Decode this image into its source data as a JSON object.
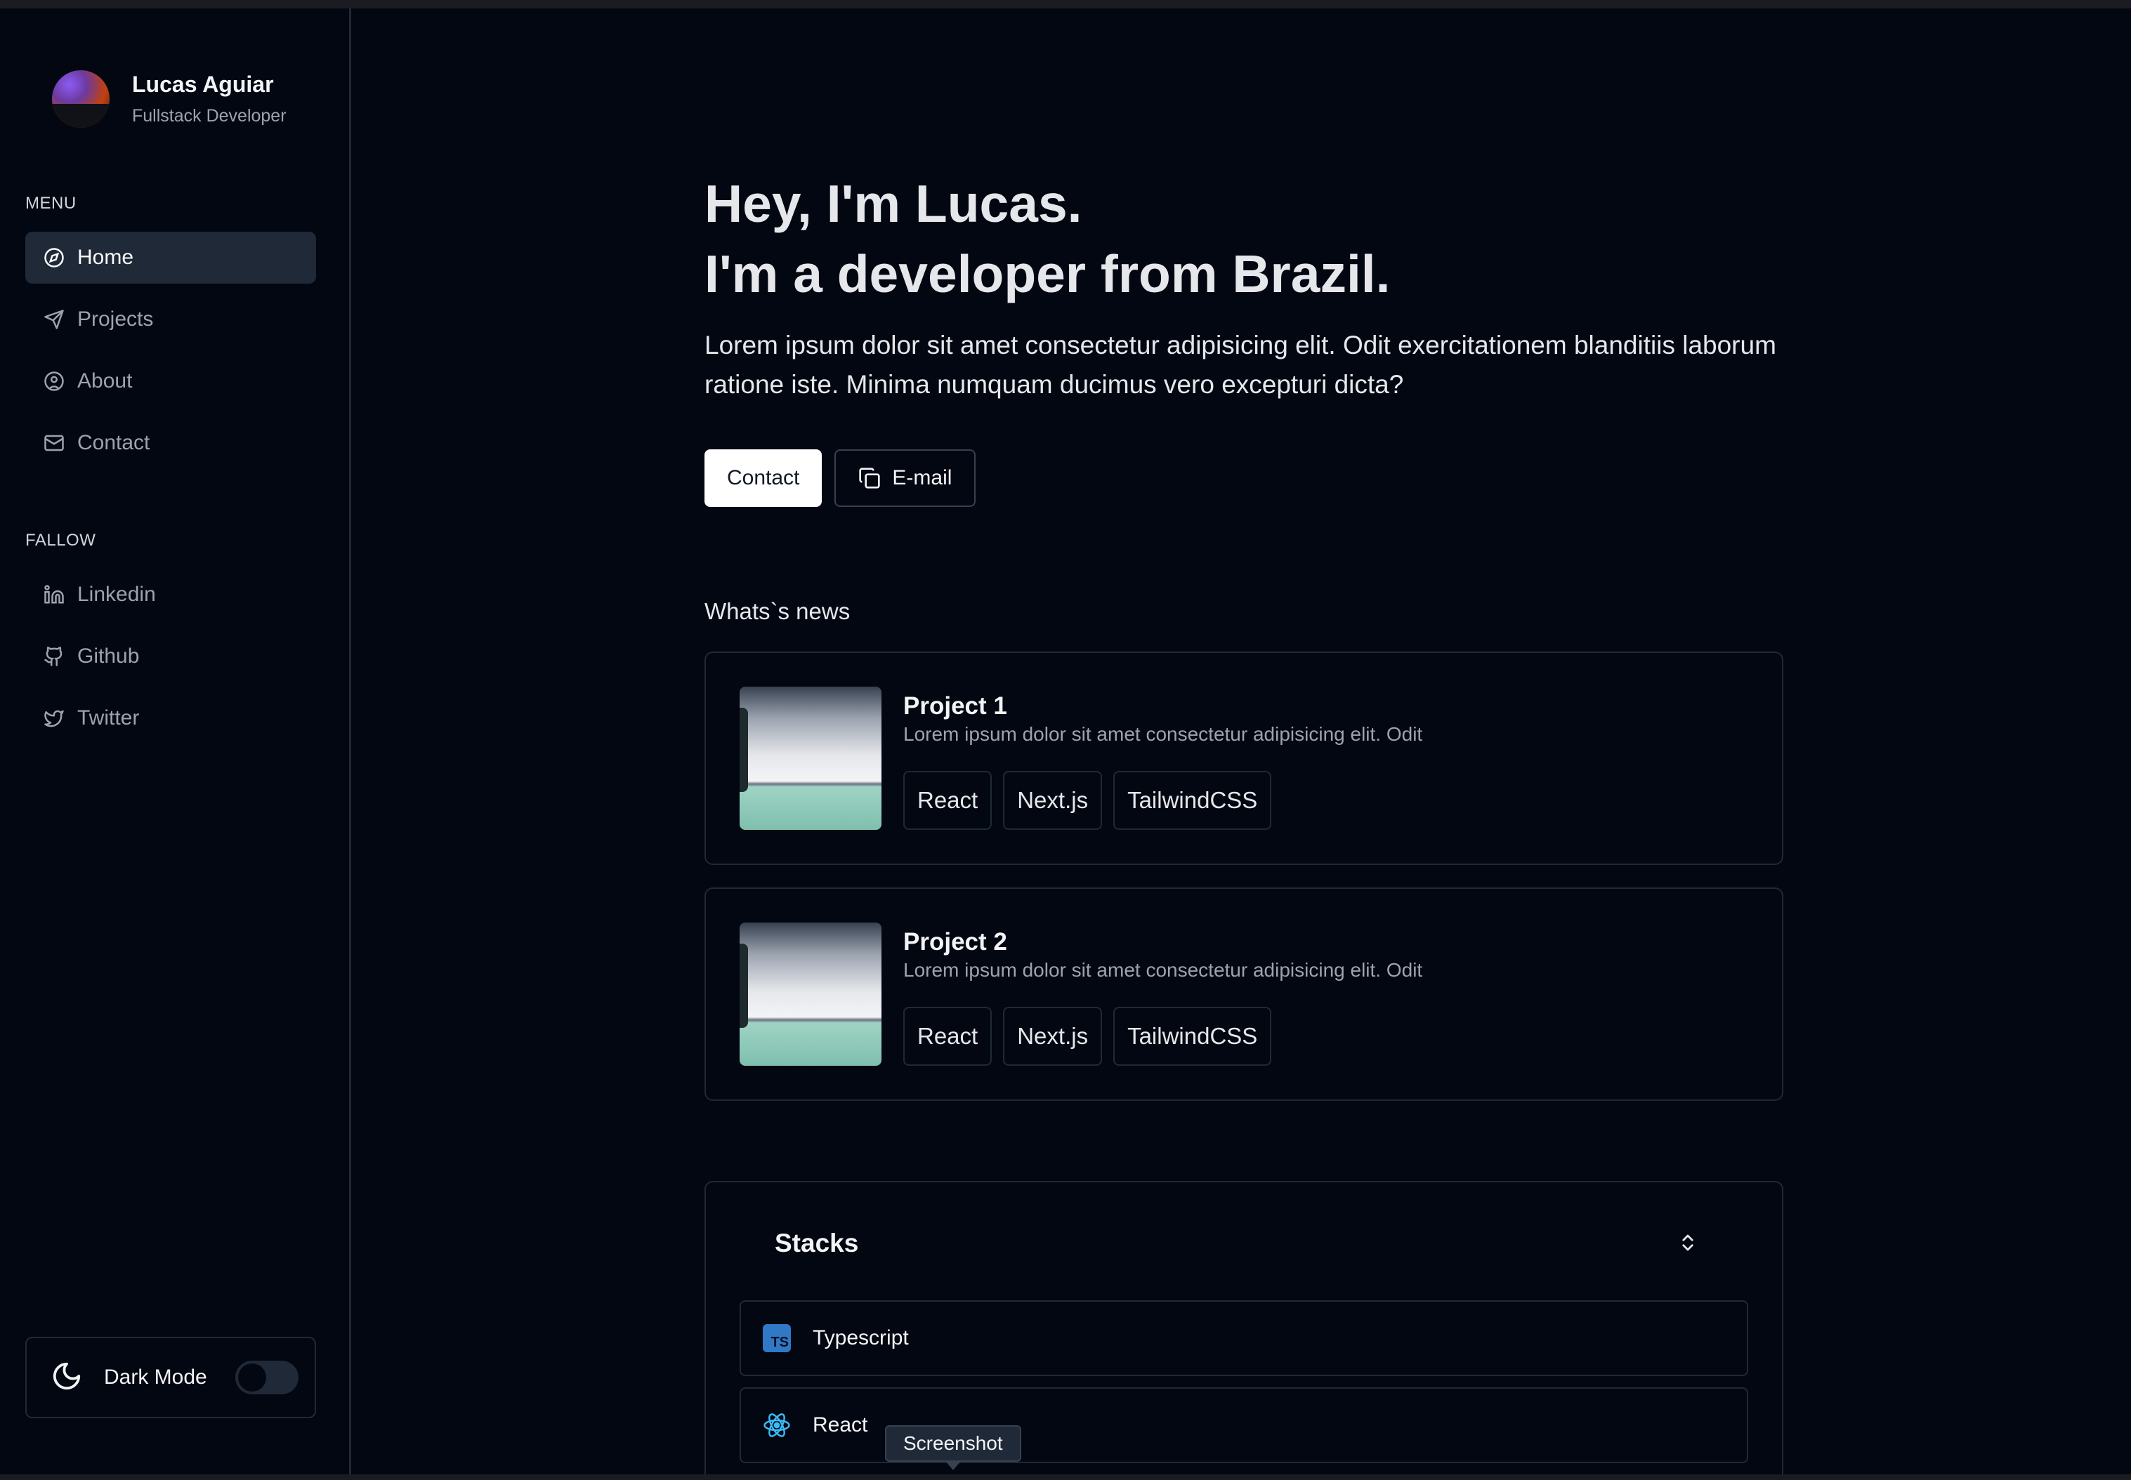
{
  "profile": {
    "name": "Lucas Aguiar",
    "role": "Fullstack Developer"
  },
  "sidebar": {
    "menu_label": "MENU",
    "menu_items": [
      {
        "label": "Home",
        "icon": "compass-icon",
        "active": true
      },
      {
        "label": "Projects",
        "icon": "send-icon",
        "active": false
      },
      {
        "label": "About",
        "icon": "user-circle-icon",
        "active": false
      },
      {
        "label": "Contact",
        "icon": "mail-icon",
        "active": false
      }
    ],
    "follow_label": "FALLOW",
    "follow_items": [
      {
        "label": "Linkedin",
        "icon": "linkedin-icon"
      },
      {
        "label": "Github",
        "icon": "github-icon"
      },
      {
        "label": "Twitter",
        "icon": "twitter-icon"
      }
    ],
    "dark_mode": {
      "label": "Dark Mode",
      "enabled": false
    }
  },
  "hero": {
    "title_line1": "Hey, I'm Lucas.",
    "title_line2": "I'm a developer from Brazil.",
    "description": "Lorem ipsum dolor sit amet consectetur adipisicing elit. Odit exercitationem blanditiis laborum ratione iste. Minima numquam ducimus vero excepturi dicta?",
    "contact_button": "Contact",
    "email_button": "E-mail"
  },
  "news": {
    "title": "Whats`s news",
    "projects": [
      {
        "title": "Project 1",
        "description": "Lorem ipsum dolor sit amet consectetur adipisicing elit. Odit",
        "tags": [
          "React",
          "Next.js",
          "TailwindCSS"
        ]
      },
      {
        "title": "Project 2",
        "description": "Lorem ipsum dolor sit amet consectetur adipisicing elit. Odit",
        "tags": [
          "React",
          "Next.js",
          "TailwindCSS"
        ]
      }
    ]
  },
  "stacks": {
    "title": "Stacks",
    "items": [
      {
        "label": "Typescript",
        "icon": "typescript-icon",
        "icon_text": "TS"
      },
      {
        "label": "React",
        "icon": "react-icon"
      }
    ]
  },
  "tooltip": "Screenshot",
  "colors": {
    "background": "#030712",
    "border": "#1f2937",
    "active_nav": "#1f2937",
    "text_muted": "#9ca3af",
    "typescript": "#3178c6",
    "react": "#38bdf8"
  }
}
